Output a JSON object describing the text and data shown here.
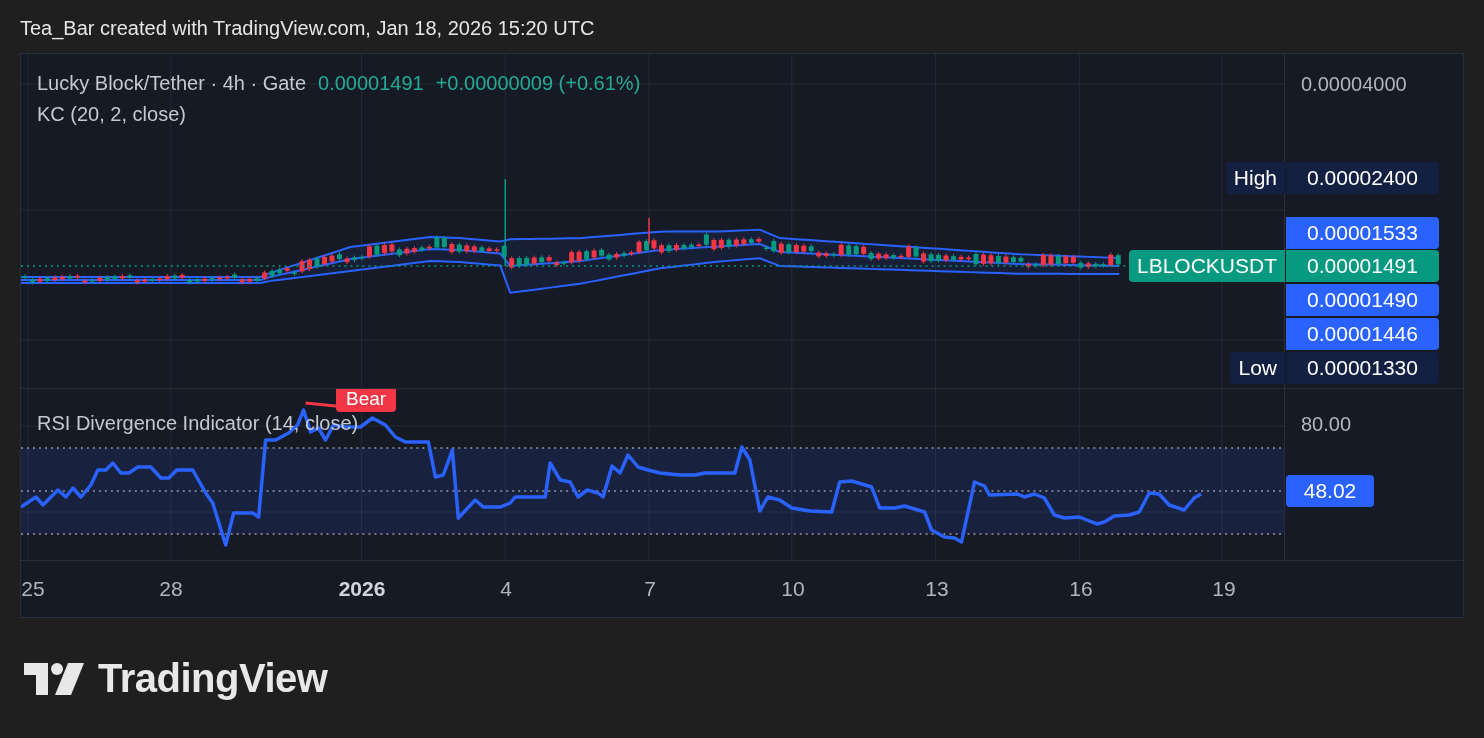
{
  "caption": "Tea_Bar created with TradingView.com, Jan 18, 2026 15:20 UTC",
  "legend": {
    "symbol": "Lucky Block/Tether · 4h · Gate",
    "price": "0.00001491",
    "change": "+0.00000009 (+0.61%)"
  },
  "indicators": [
    {
      "label": "KC (20, 2, close)"
    }
  ],
  "price_scale": {
    "ticks": [
      "0.00004000"
    ]
  },
  "price_tags": [
    {
      "kind": "high",
      "name": "High",
      "value": "0.00002400"
    },
    {
      "kind": "line",
      "value": "0.00001533"
    },
    {
      "kind": "last",
      "name": "LBLOCKUSDT",
      "value": "0.00001491"
    },
    {
      "kind": "line",
      "value": "0.00001490"
    },
    {
      "kind": "line",
      "value": "0.00001446"
    },
    {
      "kind": "low",
      "name": "Low",
      "value": "0.00001330"
    }
  ],
  "rsi": {
    "label": "RSI Divergence Indicator (14, close)",
    "signal": "Bear",
    "ticks": [
      "80.00"
    ],
    "value": "48.02"
  },
  "time_axis": [
    {
      "label": "25",
      "bold": false
    },
    {
      "label": "28",
      "bold": false
    },
    {
      "label": "2026",
      "bold": true
    },
    {
      "label": "4",
      "bold": false
    },
    {
      "label": "7",
      "bold": false
    },
    {
      "label": "10",
      "bold": false
    },
    {
      "label": "13",
      "bold": false
    },
    {
      "label": "16",
      "bold": false
    },
    {
      "label": "19",
      "bold": false
    }
  ],
  "brand": "TradingView"
}
